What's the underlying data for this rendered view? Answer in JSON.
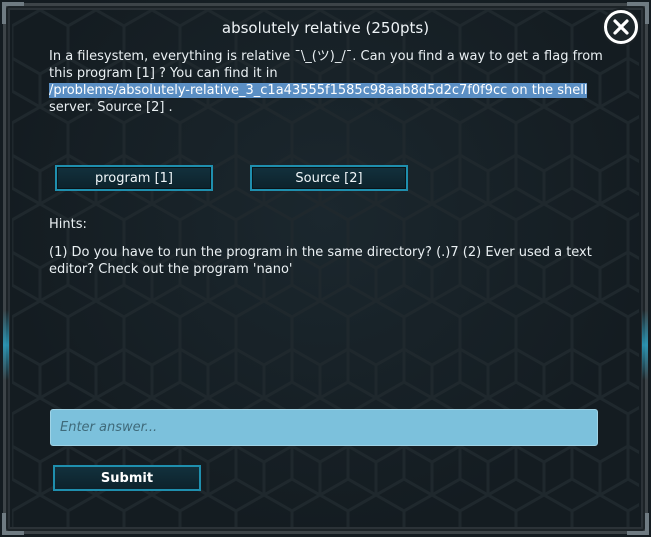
{
  "dialog": {
    "title": "absolutely relative (250pts)",
    "description_part1": "In a filesystem, everything is relative ¯\\_(ツ)_/¯. Can you find a way to get a flag from this program [1] ? You can find it in",
    "description_path": "/problems/absolutely-relative_3_c1a43555f1585c98aab8d5d2c7f0f9cc on the shell",
    "description_part2": "server. Source [2] ."
  },
  "buttons": {
    "program_label": "program [1]",
    "source_label": "Source [2]",
    "submit_label": "Submit"
  },
  "hints": {
    "label": "Hints:",
    "text": "(1) Do you have to run the program in the same directory? (.)7 (2) Ever used a text editor? Check out the program 'nano'"
  },
  "answer": {
    "placeholder": "Enter answer...",
    "value": ""
  },
  "icons": {
    "close": "close-icon"
  },
  "colors": {
    "accent": "#1f8fae",
    "input_bg": "#7cc1dc",
    "highlight": "#5b8fc4"
  }
}
